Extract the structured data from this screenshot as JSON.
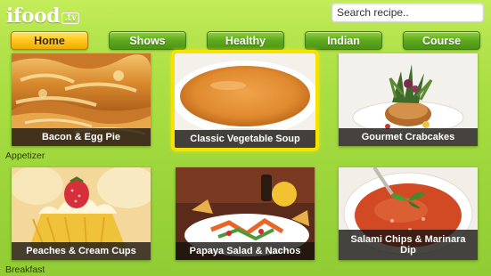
{
  "header": {
    "logo_word": "ifood",
    "logo_tld": ".tv",
    "search_placeholder": "Search recipe.."
  },
  "nav": {
    "tabs": [
      {
        "label": "Home",
        "active": true
      },
      {
        "label": "Shows",
        "active": false
      },
      {
        "label": "Healthy",
        "active": false
      },
      {
        "label": "Indian",
        "active": false
      },
      {
        "label": "Course",
        "active": false
      }
    ]
  },
  "sections": [
    {
      "label": "Appetizer",
      "items": [
        {
          "title": "Bacon & Egg Pie",
          "icon": "pastry-pie-image"
        },
        {
          "title": "Classic Vegetable Soup",
          "icon": "soup-bowl-image",
          "selected": true
        },
        {
          "title": "Gourmet Crabcakes",
          "icon": "crabcake-plate-image"
        }
      ]
    },
    {
      "label": "Breakfast",
      "items": [
        {
          "title": "Peaches & Cream Cups",
          "icon": "cream-cup-image"
        },
        {
          "title": "Papaya Salad & Nachos",
          "icon": "salad-plate-image"
        },
        {
          "title": "Salami Chips & Marinara Dip",
          "icon": "marinara-dip-image"
        }
      ]
    }
  ],
  "colors": {
    "background": "#9fd63a",
    "nav_active": "#ffc81a",
    "nav_inactive": "#5ea81f",
    "selected_border": "#f6e100"
  }
}
